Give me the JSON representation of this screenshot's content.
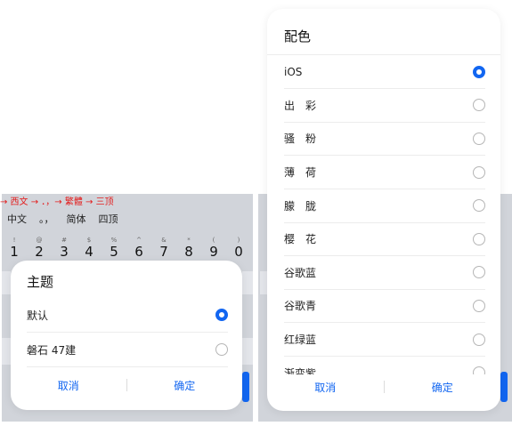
{
  "left": {
    "keyboard": {
      "hint": "→ 西文 → ．，→ 繁體 → 三顶",
      "candidates": [
        "中文",
        "。，",
        "简体",
        "四顶"
      ],
      "number_keys": [
        {
          "alt": "!",
          "main": "1"
        },
        {
          "alt": "@",
          "main": "2"
        },
        {
          "alt": "#",
          "main": "3"
        },
        {
          "alt": "$",
          "main": "4"
        },
        {
          "alt": "%",
          "main": "5"
        },
        {
          "alt": "^",
          "main": "6"
        },
        {
          "alt": "&",
          "main": "7"
        },
        {
          "alt": "*",
          "main": "8"
        },
        {
          "alt": "(",
          "main": "9"
        },
        {
          "alt": ")",
          "main": "0"
        }
      ]
    },
    "sheet": {
      "title": "主题",
      "options": [
        {
          "label": "默认",
          "selected": true
        },
        {
          "label": "磐石 47建",
          "selected": false
        }
      ],
      "cancel": "取消",
      "confirm": "确定"
    }
  },
  "right": {
    "sheet": {
      "title": "配色",
      "options": [
        {
          "label": "iOS",
          "selected": true
        },
        {
          "label": "出　彩",
          "selected": false
        },
        {
          "label": "骚　粉",
          "selected": false
        },
        {
          "label": "薄　荷",
          "selected": false
        },
        {
          "label": "朦　胧",
          "selected": false
        },
        {
          "label": "樱　花",
          "selected": false
        },
        {
          "label": "谷歌蓝",
          "selected": false
        },
        {
          "label": "谷歌青",
          "selected": false
        },
        {
          "label": "红绿蓝",
          "selected": false
        },
        {
          "label": "渐变紫",
          "selected": false
        }
      ],
      "cancel": "取消",
      "confirm": "确定"
    }
  },
  "colors": {
    "accent": "#1266f1",
    "hint_red": "#e31b1b",
    "keyboard_bg": "#d1d4da"
  }
}
